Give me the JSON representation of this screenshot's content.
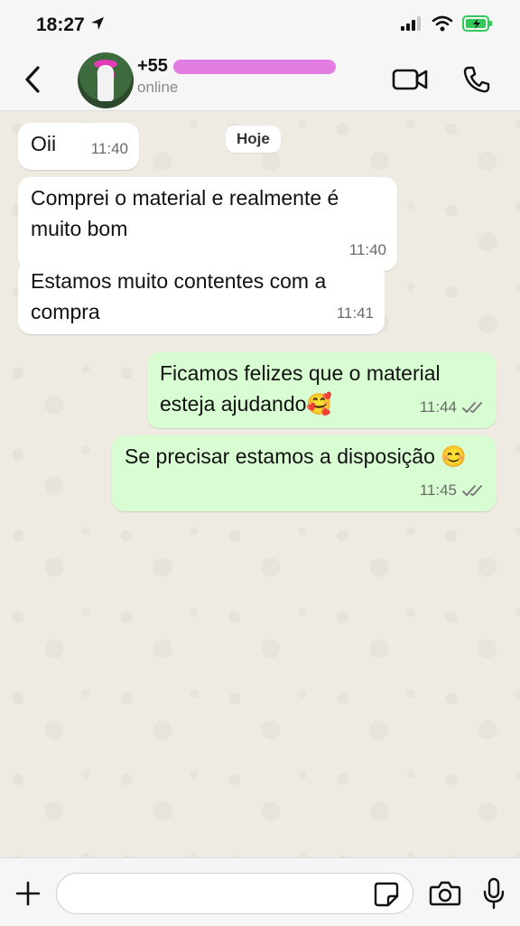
{
  "status_bar": {
    "time": "18:27",
    "battery_color": "#34c759"
  },
  "header": {
    "phone": "+55",
    "status": "online"
  },
  "chat": {
    "date_chip": "Hoje",
    "messages": [
      {
        "direction": "in",
        "text": "Oii",
        "time": "11:40"
      },
      {
        "direction": "in",
        "text": "Comprei o material e realmente é muito bom",
        "time": "11:40"
      },
      {
        "direction": "in",
        "text": "Estamos muito contentes com a compra",
        "time": "11:41"
      },
      {
        "direction": "out",
        "text": "Ficamos felizes que o material esteja ajudando🥰",
        "time": "11:44",
        "status": "read"
      },
      {
        "direction": "out",
        "text": "Se precisar estamos a disposição 😊",
        "time": "11:45",
        "status": "read"
      }
    ]
  },
  "input": {
    "placeholder": "",
    "value": ""
  },
  "colors": {
    "chat_bg": "#efeae2",
    "outgoing_bubble": "#d9fdd3",
    "incoming_bubble": "#ffffff",
    "bar_bg": "#f6f6f6"
  }
}
